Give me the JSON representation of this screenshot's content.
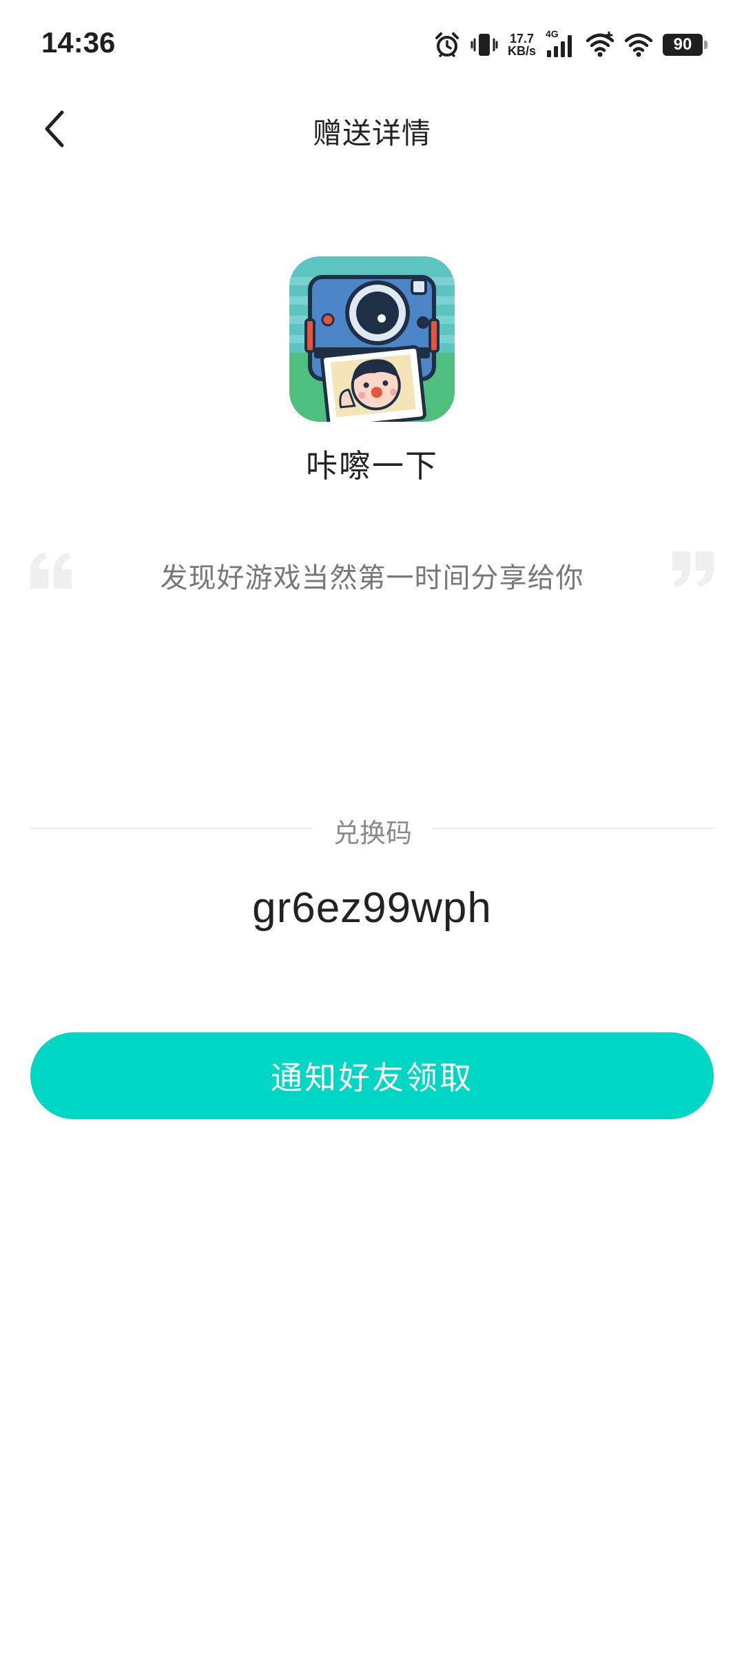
{
  "status_bar": {
    "time": "14:36",
    "net_speed_value": "17.7",
    "net_speed_unit": "KB/s",
    "network_type": "4G",
    "battery": "90",
    "icons": [
      "alarm-icon",
      "vibrate-icon",
      "cellular-signal-icon",
      "wifi-icon",
      "wifi-icon",
      "battery-icon"
    ]
  },
  "header": {
    "back_icon": "chevron-left-icon",
    "title": "赠送详情"
  },
  "app": {
    "name": "咔嚓一下",
    "icon": "camera-app-icon"
  },
  "quote": {
    "text": "发现好游戏当然第一时间分享给你"
  },
  "redeem": {
    "label": "兑换码",
    "code": "gr6ez99wph"
  },
  "actions": {
    "notify_label": "通知好友领取"
  },
  "colors": {
    "accent": "#00d6c4",
    "text_primary": "#222222",
    "text_secondary": "#777777",
    "divider": "#ececec"
  }
}
